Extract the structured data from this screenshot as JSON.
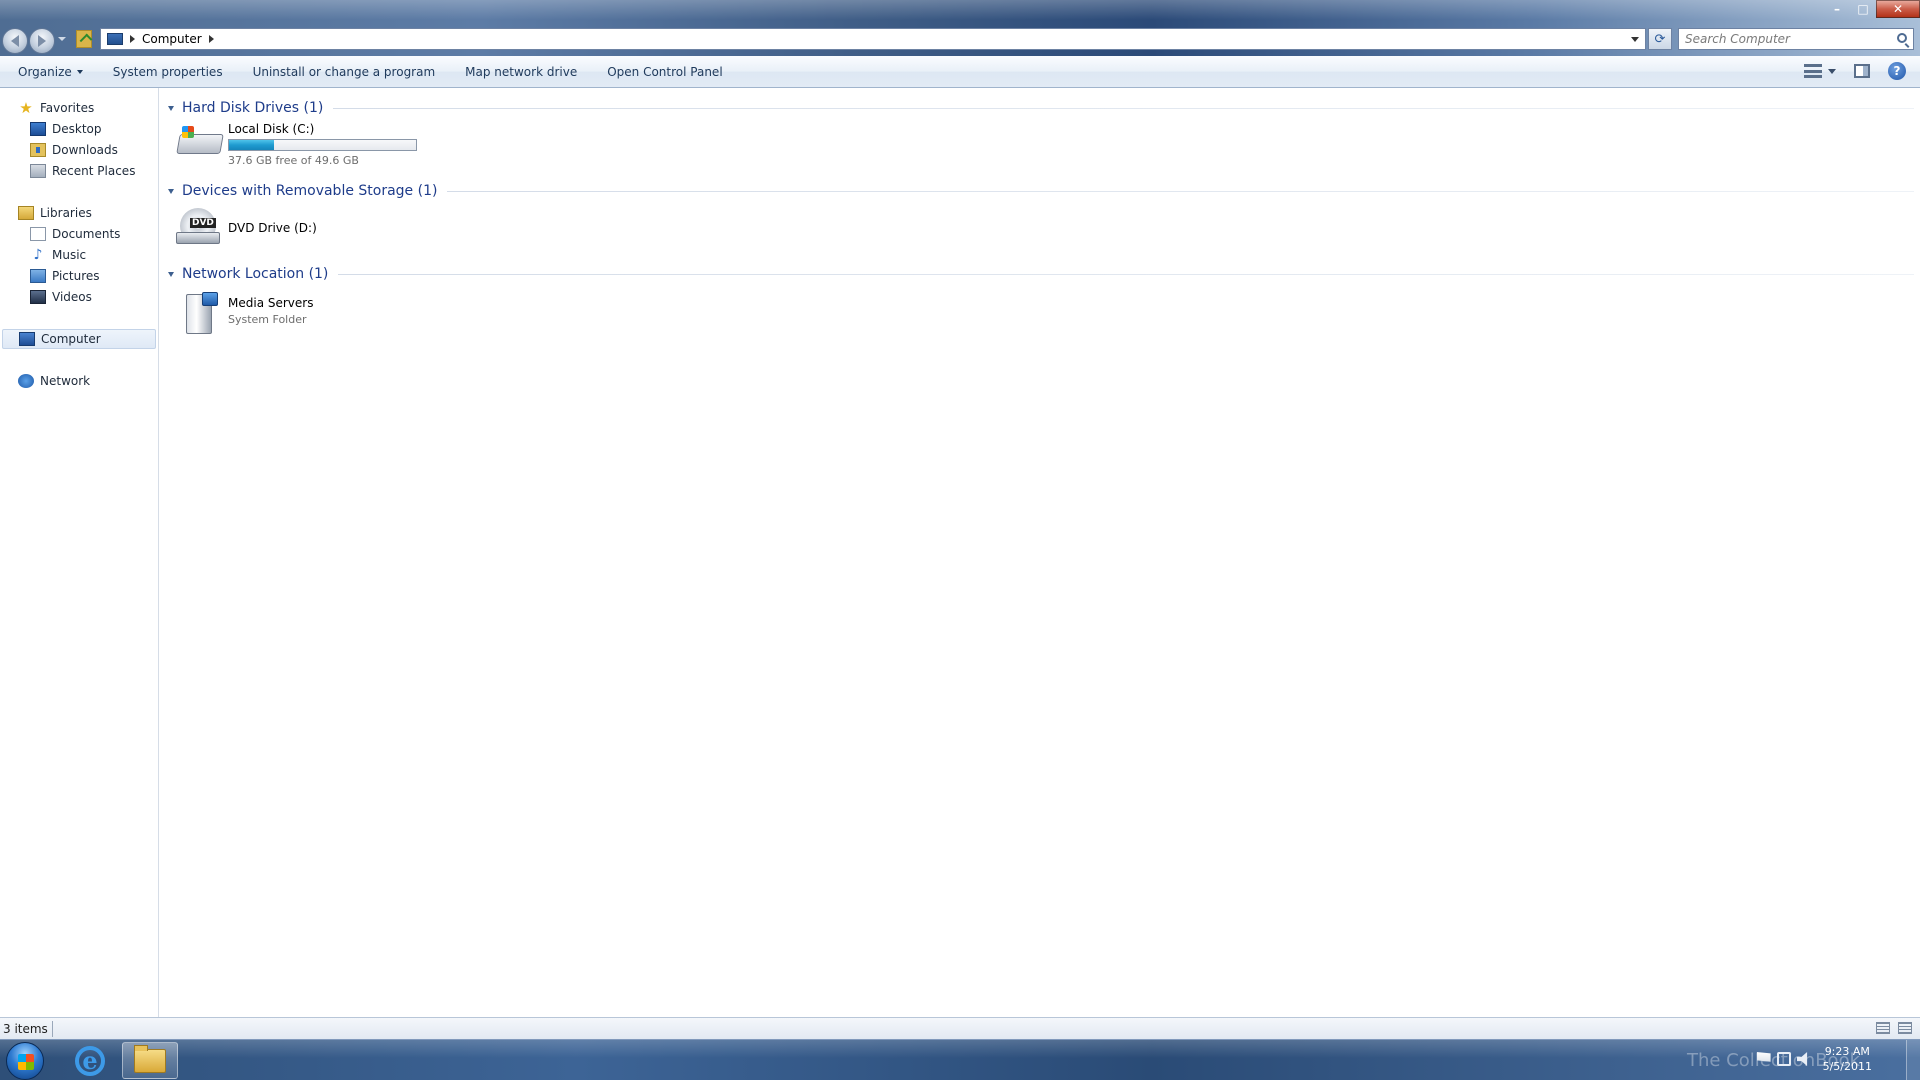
{
  "window": {
    "address": {
      "crumbs": [
        "Computer"
      ]
    },
    "search": {
      "placeholder": "Search Computer"
    },
    "controls": {
      "minimize": "–",
      "maximize": "□",
      "close": "✕"
    }
  },
  "commandbar": {
    "organize": "Organize",
    "system_properties": "System properties",
    "uninstall": "Uninstall or change a program",
    "map_drive": "Map network drive",
    "control_panel": "Open Control Panel",
    "help": "?"
  },
  "navigation": {
    "favorites": "Favorites",
    "favorites_items": [
      "Desktop",
      "Downloads",
      "Recent Places"
    ],
    "libraries": "Libraries",
    "libraries_items": [
      "Documents",
      "Music",
      "Pictures",
      "Videos"
    ],
    "computer": "Computer",
    "network": "Network"
  },
  "groups": {
    "hard_disk": {
      "title": "Hard Disk Drives (1)",
      "item": {
        "name": "Local Disk (C:)",
        "free": "37.6 GB free of 49.6 GB",
        "used_fraction": 0.24
      }
    },
    "removable": {
      "title": "Devices with Removable Storage (1)",
      "item": {
        "name": "DVD Drive (D:)",
        "badge": "DVD"
      }
    },
    "network": {
      "title": "Network Location (1)",
      "item": {
        "name": "Media Servers",
        "type": "System Folder"
      }
    }
  },
  "status": {
    "items": "3 items"
  },
  "taskbar": {
    "ie_glyph": "e",
    "clock_time": "9:23 AM",
    "clock_date": "5/5/2011",
    "watermark": "The CollectionBook"
  },
  "colors": {
    "group_title": "#1e3c8a",
    "capacity_fill": "#1f9bd0",
    "taskbar": "#2e4f78"
  }
}
